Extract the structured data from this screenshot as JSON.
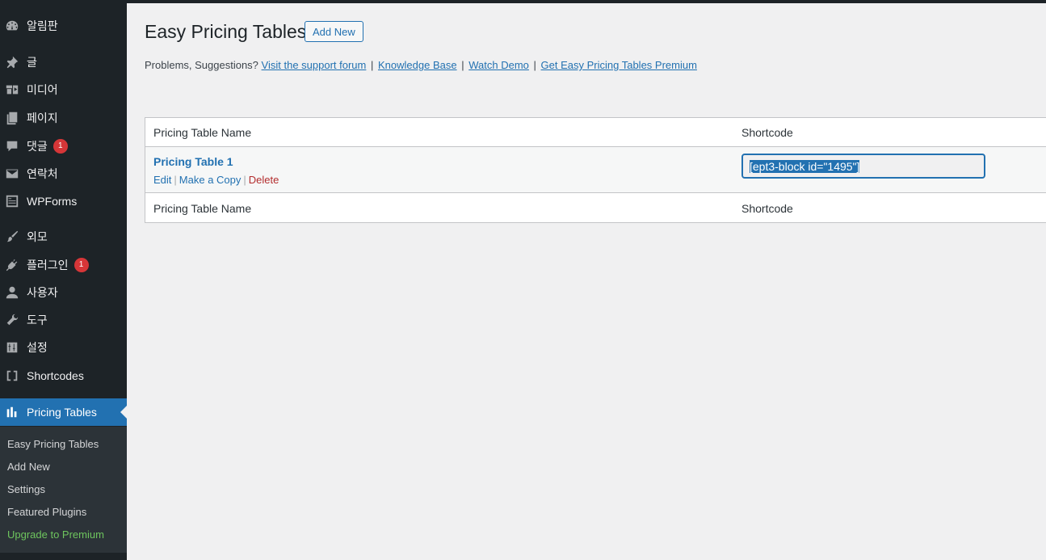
{
  "sidebar": {
    "items": [
      {
        "label": "알림판",
        "icon": "dashboard-icon"
      },
      {
        "label": "글",
        "icon": "pushpin-icon"
      },
      {
        "label": "미디어",
        "icon": "media-icon"
      },
      {
        "label": "페이지",
        "icon": "page-icon"
      },
      {
        "label": "댓글",
        "icon": "comment-icon",
        "badge": "1"
      },
      {
        "label": "연락처",
        "icon": "envelope-icon"
      },
      {
        "label": "WPForms",
        "icon": "form-icon"
      },
      {
        "label": "외모",
        "icon": "paintbrush-icon"
      },
      {
        "label": "플러그인",
        "icon": "plugin-icon",
        "badge": "1"
      },
      {
        "label": "사용자",
        "icon": "user-icon"
      },
      {
        "label": "도구",
        "icon": "wrench-icon"
      },
      {
        "label": "설정",
        "icon": "settings-icon"
      },
      {
        "label": "Shortcodes",
        "icon": "brackets-icon"
      },
      {
        "label": "Pricing Tables",
        "icon": "bar-chart-icon",
        "active": true
      }
    ],
    "submenu": [
      {
        "label": "Easy Pricing Tables"
      },
      {
        "label": "Add New"
      },
      {
        "label": "Settings"
      },
      {
        "label": "Featured Plugins"
      },
      {
        "label": "Upgrade to Premium",
        "color": "#6ec55e"
      }
    ]
  },
  "main": {
    "title": "Easy Pricing Tables",
    "add_new_label": "Add New",
    "links_prefix": "Problems, Suggestions?",
    "links": [
      "Visit the support forum",
      "Knowledge Base",
      "Watch Demo",
      "Get Easy Pricing Tables Premium"
    ],
    "separator": "|",
    "table": {
      "headers": [
        "Pricing Table Name",
        "Shortcode"
      ],
      "rows": [
        {
          "name": "Pricing Table 1",
          "actions": [
            "Edit",
            "Make a Copy",
            "Delete"
          ],
          "shortcode": "[ept3-block id=\"1495\"]"
        }
      ],
      "footers": [
        "Pricing Table Name",
        "Shortcode"
      ]
    }
  },
  "colors": {
    "accent": "#2271b1",
    "sidebar_bg": "#1d2327",
    "submenu_bg": "#2c3338",
    "badge": "#d63638",
    "delete": "#b32d2e",
    "upgrade": "#6ec55e"
  }
}
